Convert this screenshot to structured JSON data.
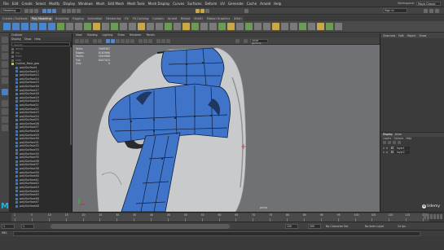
{
  "menubar": {
    "items": [
      "File",
      "Edit",
      "Create",
      "Select",
      "Modify",
      "Display",
      "Windows",
      "Mesh",
      "Edit Mesh",
      "Mesh Tools",
      "Mesh Display",
      "Curves",
      "Surfaces",
      "Deform",
      "UV",
      "Generate",
      "Cache",
      "Arnold",
      "Help"
    ],
    "workspace_label": "Workspace:",
    "workspace_value": "Maya Classic"
  },
  "status_line": {
    "mode": "Modeling",
    "sign_in": "Sign In"
  },
  "shelf_tabs": [
    "Curves / Surfaces",
    "Poly Modeling",
    "Sculpting",
    "Rigging",
    "Animation",
    "Rendering",
    "FX",
    "FX Caching",
    "Custom",
    "Arnold",
    "Bifrost",
    "MASH",
    "Motion Graphics",
    "XGen"
  ],
  "shelf_active_tab": "Poly Modeling",
  "outliner": {
    "title": "Outliner",
    "menu": [
      "Display",
      "Show",
      "Help"
    ],
    "search_placeholder": "Search...",
    "items": [
      {
        "label": "persp",
        "kind": "dim"
      },
      {
        "label": "top",
        "kind": "dim"
      },
      {
        "label": "front",
        "kind": "dim"
      },
      {
        "label": "side",
        "kind": "dim"
      },
      {
        "label": "Outline_Male_geo",
        "kind": "grp"
      },
      {
        "label": "polySurface1",
        "kind": "mesh"
      },
      {
        "label": "polySurface12",
        "kind": "mesh"
      },
      {
        "label": "polySurface13",
        "kind": "mesh"
      },
      {
        "label": "polySurface14",
        "kind": "mesh"
      },
      {
        "label": "polySurface15",
        "kind": "mesh"
      },
      {
        "label": "polySurface16",
        "kind": "mesh"
      },
      {
        "label": "polySurface17",
        "kind": "mesh"
      },
      {
        "label": "polySurface18",
        "kind": "mesh"
      },
      {
        "label": "polySurface19",
        "kind": "mesh"
      },
      {
        "label": "polySurface20",
        "kind": "mesh"
      },
      {
        "label": "polySurface21",
        "kind": "mesh"
      },
      {
        "label": "polySurface22",
        "kind": "mesh"
      },
      {
        "label": "polySurface23",
        "kind": "mesh"
      },
      {
        "label": "polySurface24",
        "kind": "mesh"
      },
      {
        "label": "polySurface25",
        "kind": "mesh"
      },
      {
        "label": "polySurface26",
        "kind": "mesh"
      },
      {
        "label": "polySurface27",
        "kind": "mesh"
      },
      {
        "label": "polySurface28",
        "kind": "mesh"
      },
      {
        "label": "polySurface29",
        "kind": "mesh"
      },
      {
        "label": "polySurface30",
        "kind": "mesh"
      },
      {
        "label": "polySurface31",
        "kind": "mesh"
      },
      {
        "label": "polySurface32",
        "kind": "mesh"
      },
      {
        "label": "polySurface33",
        "kind": "mesh"
      },
      {
        "label": "polySurface34",
        "kind": "mesh"
      },
      {
        "label": "polySurface35",
        "kind": "mesh"
      },
      {
        "label": "polySurface36",
        "kind": "mesh"
      },
      {
        "label": "polySurface37",
        "kind": "mesh"
      },
      {
        "label": "polySurface38",
        "kind": "mesh"
      },
      {
        "label": "polySurface39",
        "kind": "mesh"
      },
      {
        "label": "polySurface40",
        "kind": "mesh"
      },
      {
        "label": "polySurface41",
        "kind": "mesh"
      },
      {
        "label": "polySurface42",
        "kind": "mesh"
      },
      {
        "label": "polySurface43",
        "kind": "mesh"
      },
      {
        "label": "polySurface44",
        "kind": "mesh"
      },
      {
        "label": "polySurface45",
        "kind": "mesh"
      },
      {
        "label": "polySurface46",
        "kind": "mesh"
      },
      {
        "label": "polySurface47",
        "kind": "mesh"
      },
      {
        "label": "polySurface48",
        "kind": "mesh"
      }
    ]
  },
  "viewport": {
    "menu": [
      "View",
      "Shading",
      "Lighting",
      "Show",
      "Renderer",
      "Panels"
    ],
    "gamma_label": "sRGB gamma",
    "hud": [
      {
        "label": "Verts:",
        "value": "3069387"
      },
      {
        "label": "Edges:",
        "value": "6183966"
      },
      {
        "label": "Faces:",
        "value": "3004986"
      },
      {
        "label": "Tris:",
        "value": "6007423"
      },
      {
        "label": "UVs:",
        "value": "0"
      }
    ],
    "camera_label": "persp",
    "selection_color": "#3f74c8",
    "mesh_color": "#c9cacc",
    "background_color": "#6f7174"
  },
  "channel_box": {
    "tabs": [
      "Channels",
      "Edit",
      "Object",
      "Show"
    ]
  },
  "layer_editor": {
    "tabs": [
      "Display",
      "Anim"
    ],
    "menu": [
      "Layers",
      "Options",
      "Help"
    ],
    "layers": [
      {
        "v": "V",
        "p": "P",
        "name": "layer1",
        "color": "#3a3a3a"
      },
      {
        "v": "V",
        "p": "P",
        "name": "layer2",
        "color": "#3a3a3a"
      }
    ]
  },
  "timeline": {
    "ticks": [
      "1",
      "5",
      "10",
      "15",
      "20",
      "25",
      "30",
      "35",
      "40",
      "45",
      "50",
      "55",
      "60",
      "65",
      "70",
      "75",
      "80",
      "85",
      "90",
      "95",
      "100",
      "105",
      "110",
      "115",
      "120"
    ],
    "current_frame": "1"
  },
  "range": {
    "start": "1",
    "inner_start": "1",
    "inner_end": "120",
    "end_a": "120",
    "end_b": "200",
    "charset": "No Character Set",
    "anim_layer": "No Anim Layer",
    "fps": "24 fps"
  },
  "command_line": {
    "language": "MEL"
  },
  "branding": {
    "maya_logo": "M",
    "udemy_label": "Udemy"
  }
}
